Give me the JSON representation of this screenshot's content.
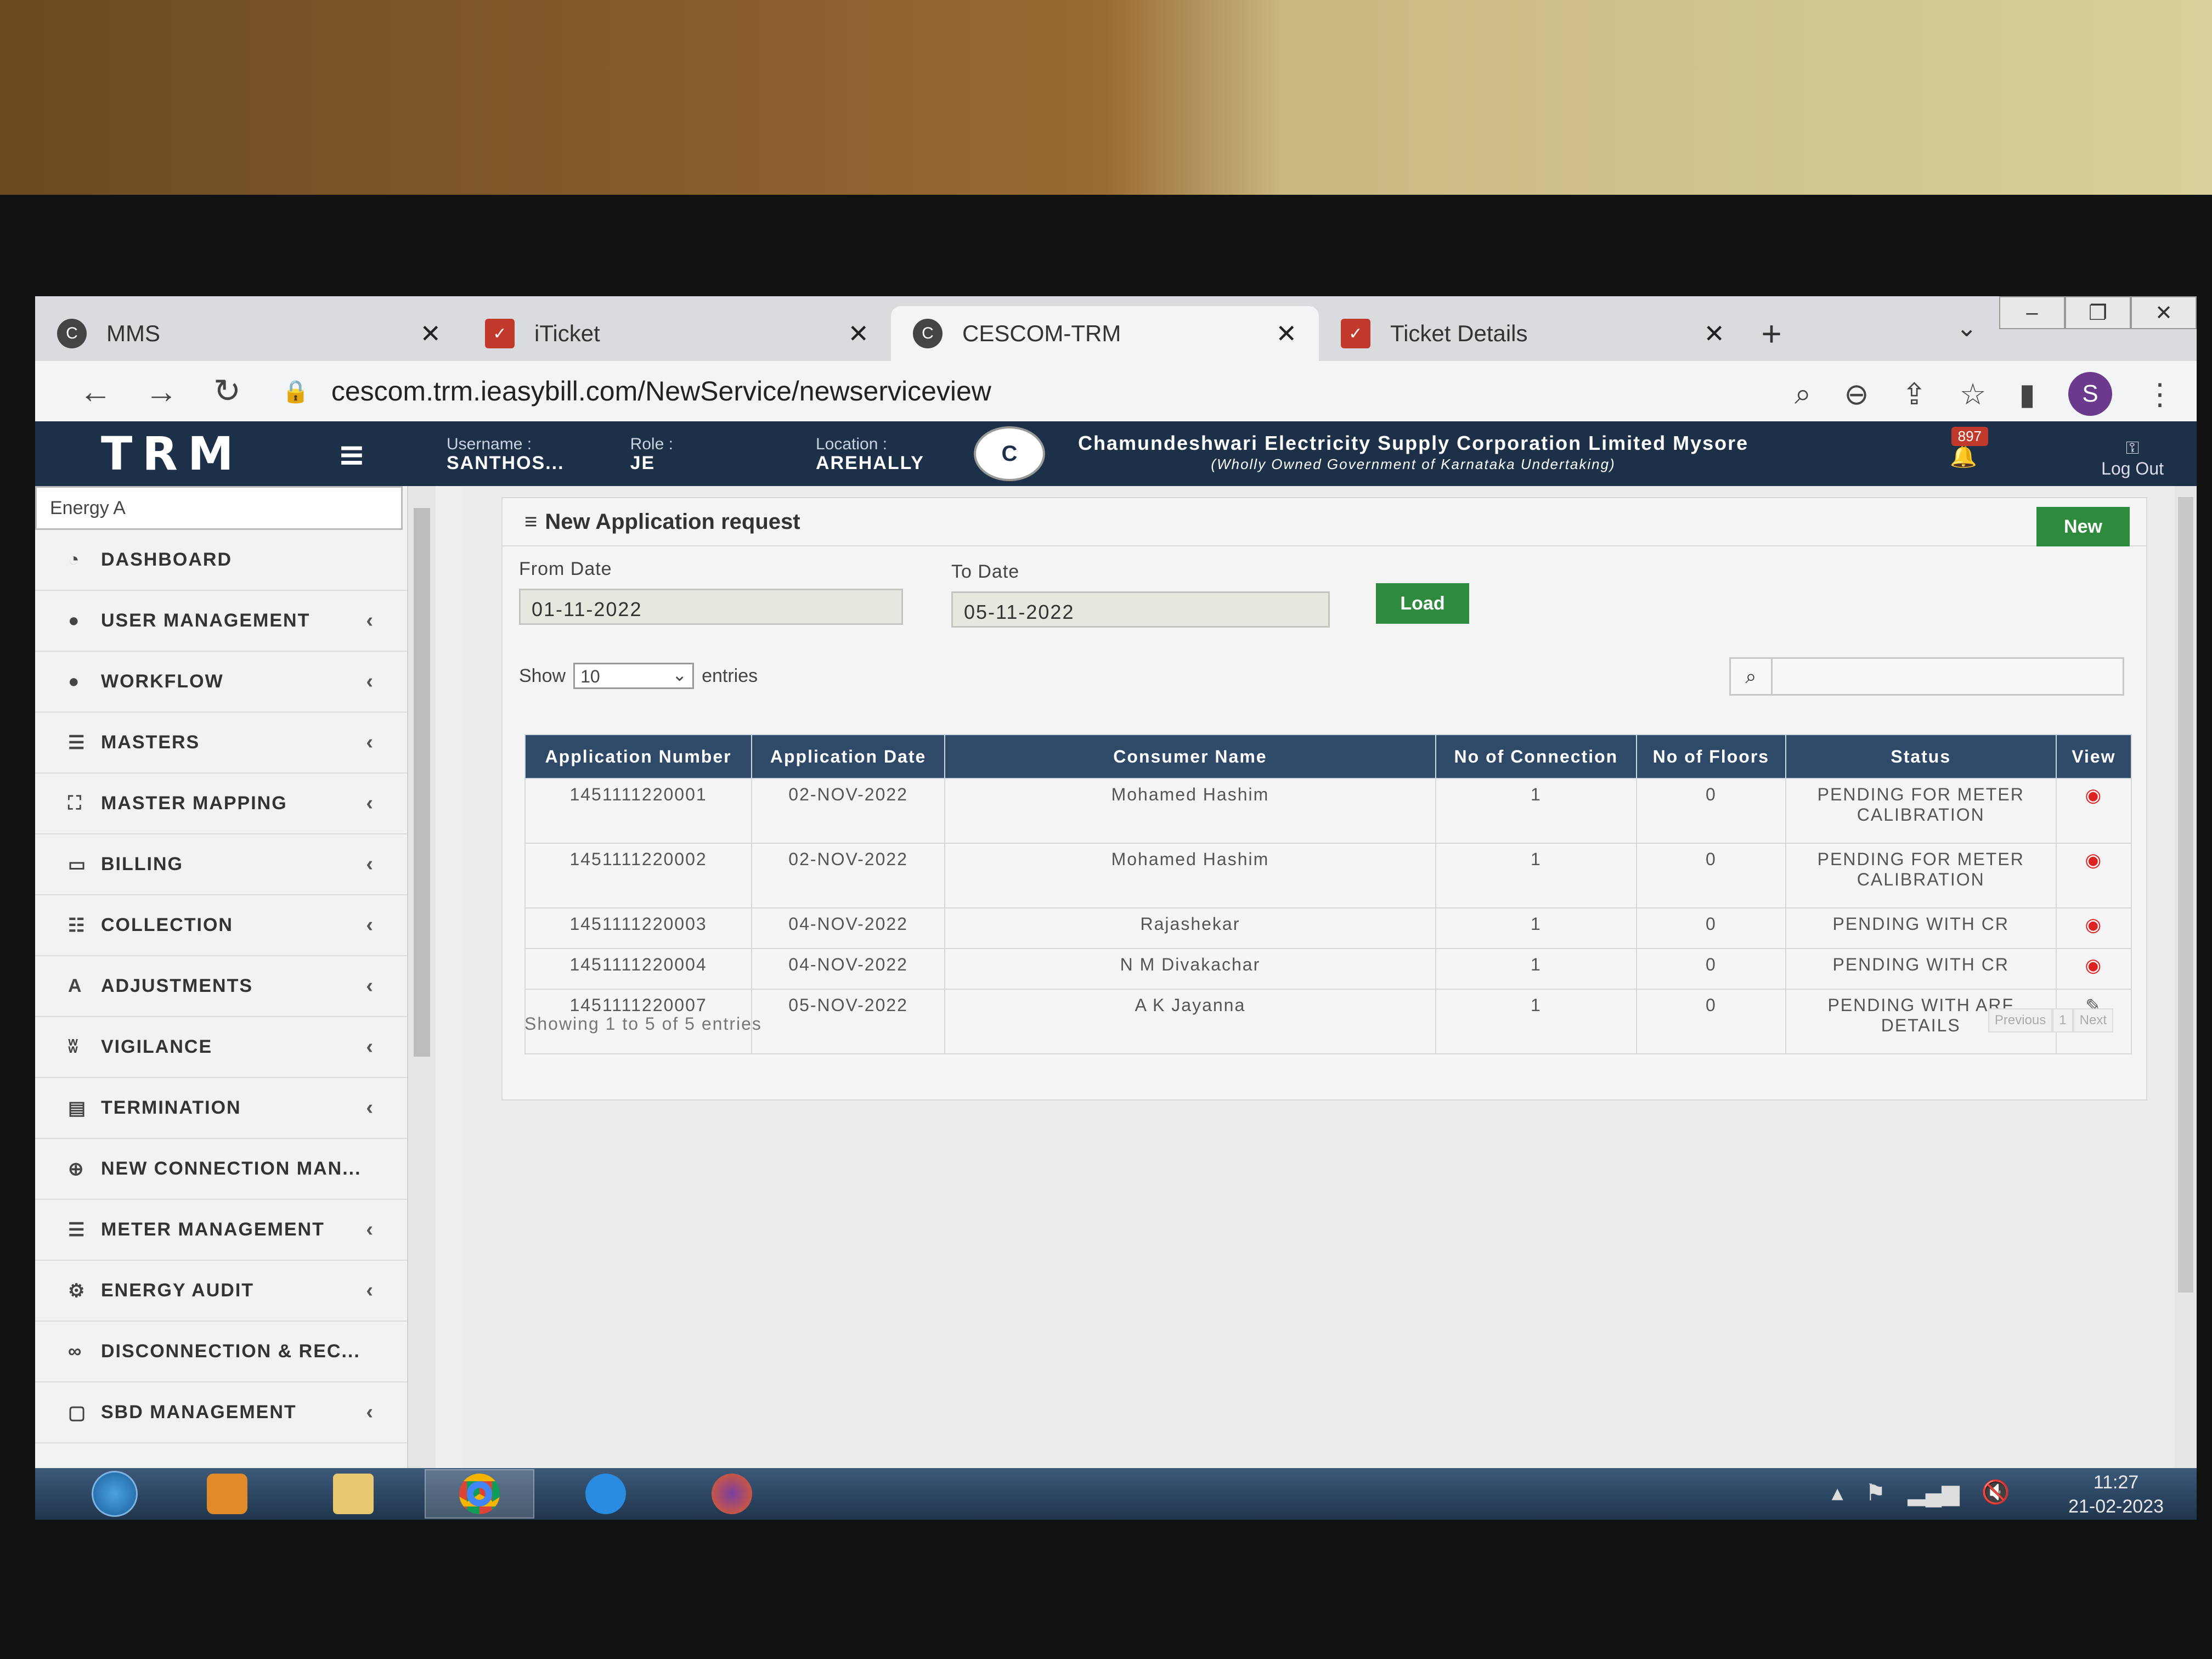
{
  "browser": {
    "tabs": [
      {
        "title": "MMS",
        "icon": "cescom-icon"
      },
      {
        "title": "iTicket",
        "icon": "iticket-icon"
      },
      {
        "title": "CESCOM-TRM",
        "icon": "cescom-icon"
      },
      {
        "title": "Ticket Details",
        "icon": "iticket-icon"
      }
    ],
    "url": "cescom.trm.ieasybill.com/NewService/newserviceview",
    "profile_initial": "S"
  },
  "header": {
    "logo": "TRM",
    "username_label": "Username :",
    "username": "SANTHOS...",
    "role_label": "Role :",
    "role": "JE",
    "location_label": "Location :",
    "location": "AREHALLY",
    "corp_name": "Chamundeshwari Electricity Supply Corporation Limited Mysore",
    "corp_sub": "(Wholly Owned Government of Karnataka Undertaking)",
    "notif_count": "897",
    "logout": "Log Out"
  },
  "sidebar": {
    "search": "Energy A",
    "items": [
      {
        "label": "DASHBOARD",
        "arrow": ""
      },
      {
        "label": "USER MANAGEMENT",
        "arrow": "‹"
      },
      {
        "label": "WORKFLOW",
        "arrow": "‹"
      },
      {
        "label": "MASTERS",
        "arrow": "‹"
      },
      {
        "label": "MASTER MAPPING",
        "arrow": "‹"
      },
      {
        "label": "BILLING",
        "arrow": "‹"
      },
      {
        "label": "COLLECTION",
        "arrow": "‹"
      },
      {
        "label": "ADJUSTMENTS",
        "arrow": "‹"
      },
      {
        "label": "VIGILANCE",
        "arrow": "‹"
      },
      {
        "label": "TERMINATION",
        "arrow": "‹"
      },
      {
        "label": "NEW CONNECTION MAN...",
        "arrow": ""
      },
      {
        "label": "METER MANAGEMENT",
        "arrow": "‹"
      },
      {
        "label": "ENERGY AUDIT",
        "arrow": "‹"
      },
      {
        "label": "DISCONNECTION & REC...",
        "arrow": ""
      },
      {
        "label": "SBD MANAGEMENT",
        "arrow": "‹"
      }
    ]
  },
  "main": {
    "title": "New Application request",
    "new_button": "New",
    "from_label": "From Date",
    "from_value": "01-11-2022",
    "to_label": "To Date",
    "to_value": "05-11-2022",
    "load_button": "Load",
    "show_label": "Show",
    "show_value": "10",
    "entries_label": "entries",
    "columns": [
      "Application Number",
      "Application Date",
      "Consumer Name",
      "No of Connection",
      "No of Floors",
      "Status",
      "View"
    ],
    "rows": [
      {
        "number": "1451111220001",
        "date": "02-NOV-2022",
        "name": "Mohamed Hashim",
        "connections": "1",
        "floors": "0",
        "status": "PENDING FOR METER CALIBRATION",
        "view": "eye"
      },
      {
        "number": "1451111220002",
        "date": "02-NOV-2022",
        "name": "Mohamed Hashim",
        "connections": "1",
        "floors": "0",
        "status": "PENDING FOR METER CALIBRATION",
        "view": "eye"
      },
      {
        "number": "1451111220003",
        "date": "04-NOV-2022",
        "name": "Rajashekar",
        "connections": "1",
        "floors": "0",
        "status": "PENDING WITH CR",
        "view": "eye"
      },
      {
        "number": "1451111220004",
        "date": "04-NOV-2022",
        "name": "N M Divakachar",
        "connections": "1",
        "floors": "0",
        "status": "PENDING WITH CR",
        "view": "eye"
      },
      {
        "number": "1451111220007",
        "date": "05-NOV-2022",
        "name": "A K Jayanna",
        "connections": "1",
        "floors": "0",
        "status": "PENDING WITH ARF DETAILS",
        "view": "edit"
      }
    ],
    "showing": "Showing 1 to 5 of 5 entries",
    "pager": {
      "previous": "Previous",
      "page": "1",
      "next": "Next"
    }
  },
  "taskbar": {
    "time": "11:27",
    "date": "21-02-2023"
  }
}
